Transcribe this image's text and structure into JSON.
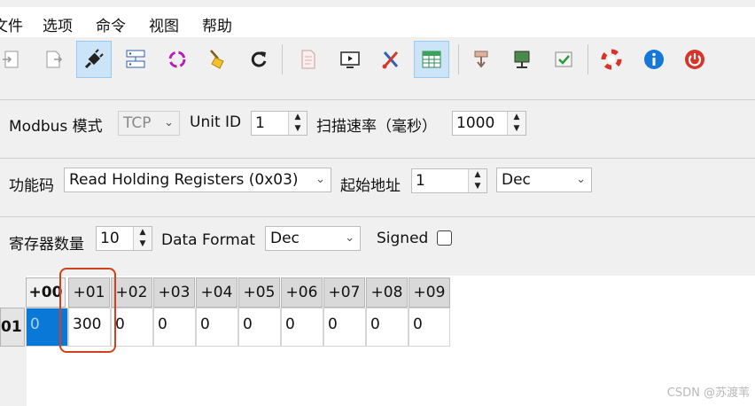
{
  "menu": [
    "文件",
    "选项",
    "命令",
    "视图",
    "帮助"
  ],
  "toolbar": {
    "icons": [
      "connect-icon",
      "disconnect-icon",
      "plug-icon",
      "network-icon",
      "refresh-circle-icon",
      "clear-broom-icon",
      "reload-icon",
      "document-icon",
      "monitor-icon",
      "tools-icon",
      "table-icon",
      "read-icon",
      "write-icon",
      "test-check-icon",
      "help-lifebuoy-icon",
      "info-icon",
      "power-icon"
    ]
  },
  "connection": {
    "mode_label": "Modbus 模式",
    "mode_value": "TCP",
    "unit_label": "Unit ID",
    "unit_value": "1",
    "scan_label": "扫描速率（毫秒）",
    "scan_value": "1000"
  },
  "function": {
    "code_label": "功能码",
    "code_value": "Read Holding Registers (0x03)",
    "start_label": "起始地址",
    "start_value": "1",
    "format_value": "Dec"
  },
  "registers": {
    "count_label": "寄存器数量",
    "count_value": "10",
    "data_format_label": "Data Format",
    "data_format_value": "Dec",
    "signed_label": "Signed",
    "signed_checked": false
  },
  "grid": {
    "headers": [
      "+00",
      "+01",
      "+02",
      "+03",
      "+04",
      "+05",
      "+06",
      "+07",
      "+08",
      "+09"
    ],
    "row_label": "01",
    "values": [
      "0",
      "300",
      "0",
      "0",
      "0",
      "0",
      "0",
      "0",
      "0",
      "0"
    ]
  },
  "watermark": "CSDN @苏渡苇"
}
